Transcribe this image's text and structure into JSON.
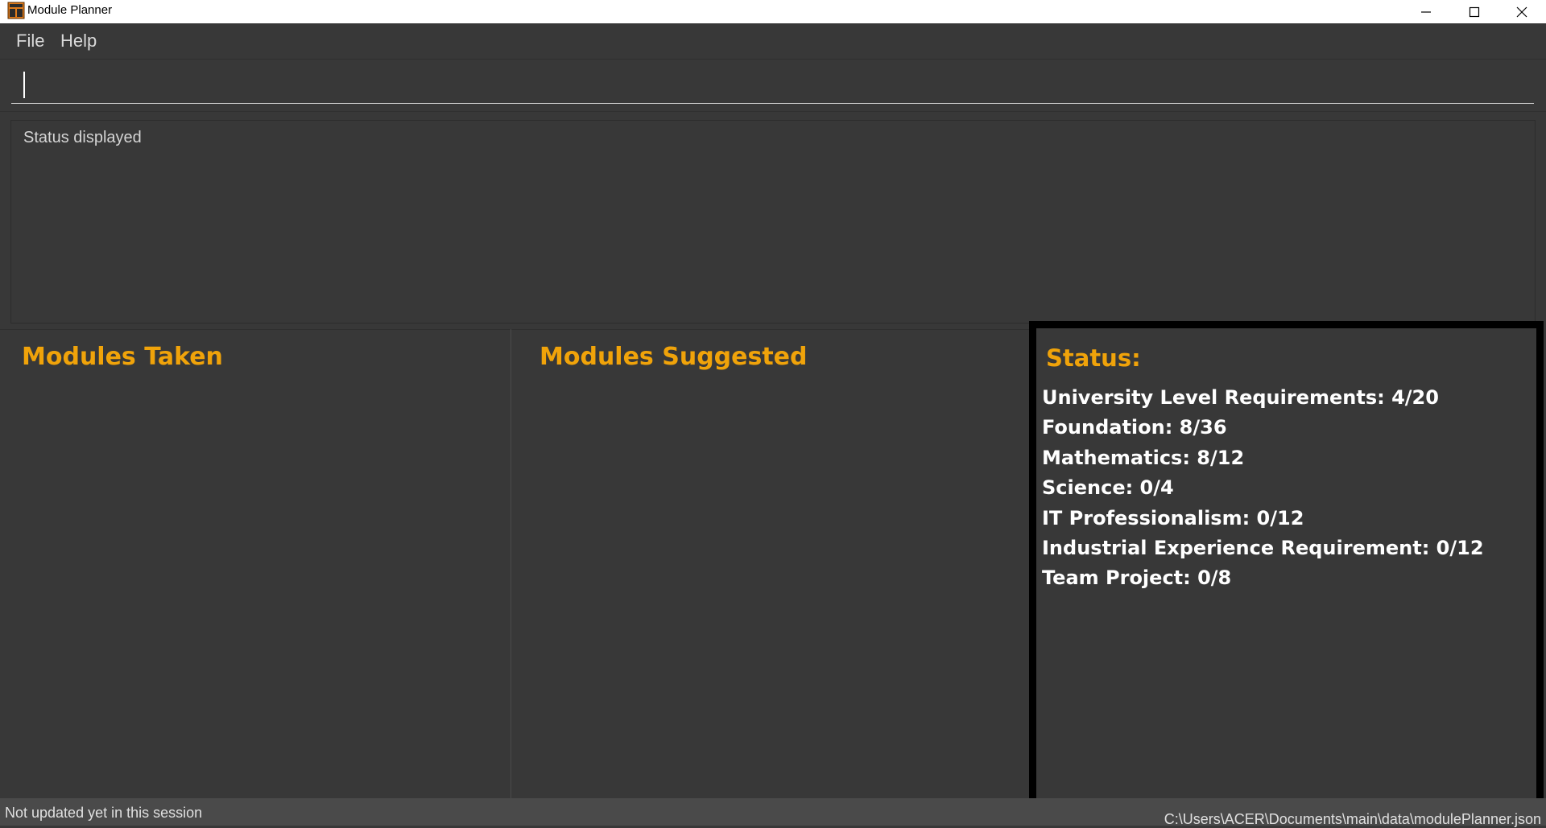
{
  "window": {
    "title": "Module Planner",
    "icon": "app-window-icon",
    "controls": [
      "minimize-icon",
      "maximize-icon",
      "close-icon"
    ]
  },
  "menu": {
    "file": "File",
    "help": "Help"
  },
  "command_box": {
    "value": ""
  },
  "result_display": {
    "text": "Status displayed"
  },
  "panels": {
    "modules_taken": {
      "title": "Modules Taken",
      "items": []
    },
    "modules_suggested": {
      "title": "Modules Suggested",
      "items": []
    },
    "status": {
      "title": "Status:",
      "requirements": [
        "University Level Requirements: 4/20",
        "Foundation: 8/36",
        "Mathematics: 8/12",
        "Science: 0/4",
        "IT Professionalism: 0/12",
        "Industrial Experience Requirement: 0/12",
        "Team Project: 0/8"
      ]
    }
  },
  "status_bar": {
    "sync": "Not updated yet in this session",
    "save_location": "C:\\Users\\ACER\\Documents\\main\\data\\modulePlanner.json"
  },
  "colors": {
    "background": "#383838",
    "accent_orange": "#f0a30a",
    "highlight_border": "#000000"
  }
}
